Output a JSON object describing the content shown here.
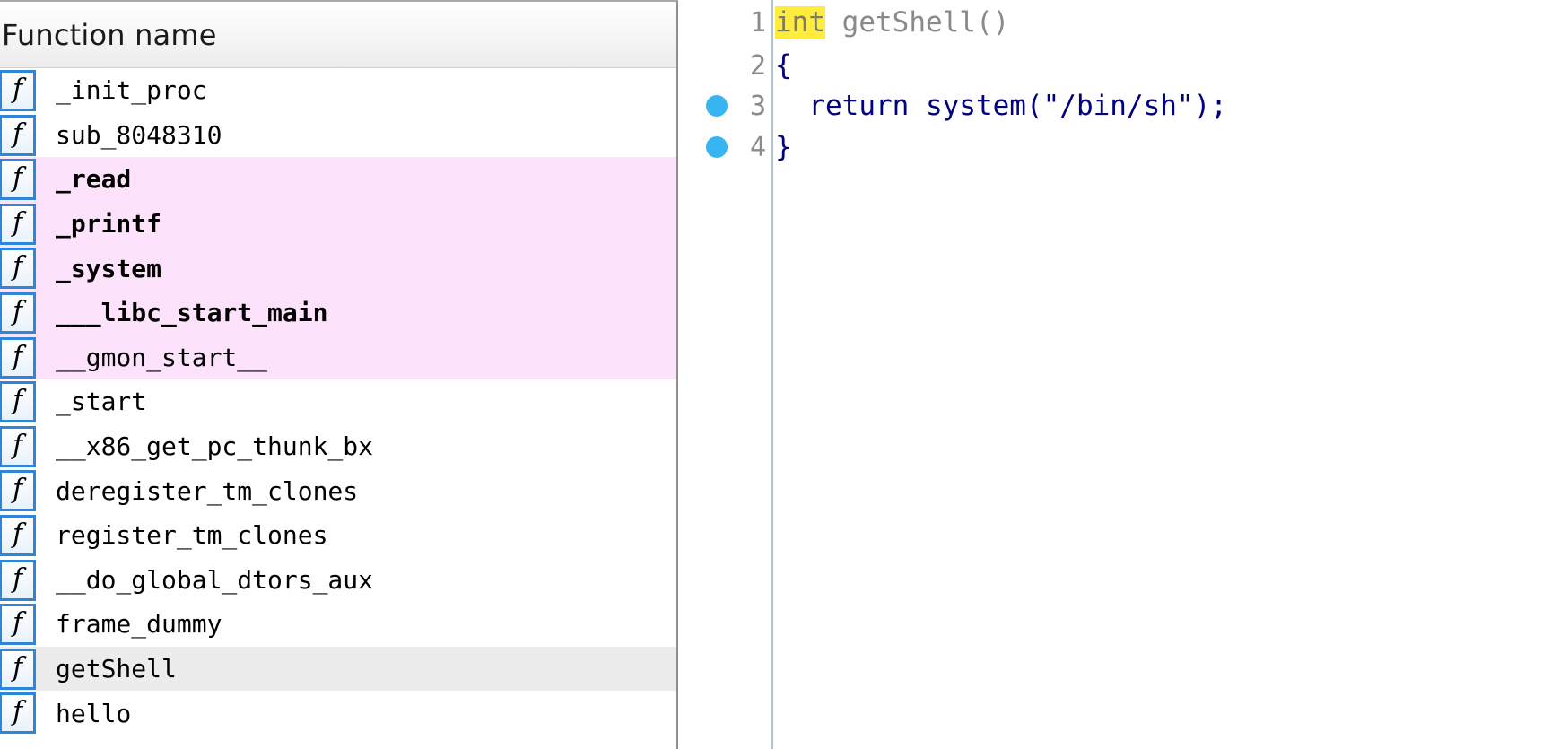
{
  "function_list": {
    "header": "Function name",
    "icon_glyph": "f",
    "rows": [
      {
        "name": "_init_proc",
        "kind": "normal"
      },
      {
        "name": "sub_8048310",
        "kind": "normal"
      },
      {
        "name": "_read",
        "kind": "library"
      },
      {
        "name": "_printf",
        "kind": "library"
      },
      {
        "name": "_system",
        "kind": "library"
      },
      {
        "name": "___libc_start_main",
        "kind": "library"
      },
      {
        "name": "__gmon_start__",
        "kind": "library"
      },
      {
        "name": "_start",
        "kind": "normal"
      },
      {
        "name": "__x86_get_pc_thunk_bx",
        "kind": "normal"
      },
      {
        "name": "deregister_tm_clones",
        "kind": "normal"
      },
      {
        "name": "register_tm_clones",
        "kind": "normal"
      },
      {
        "name": "__do_global_dtors_aux",
        "kind": "normal"
      },
      {
        "name": "frame_dummy",
        "kind": "normal"
      },
      {
        "name": "getShell",
        "kind": "selected"
      },
      {
        "name": "hello",
        "kind": "normal"
      }
    ]
  },
  "pseudocode": {
    "lines": [
      {
        "number": "1",
        "breakpoint": false,
        "parts": {
          "kw": "int",
          "rest": " getShell()"
        }
      },
      {
        "number": "2",
        "breakpoint": false,
        "parts": {
          "text": "{"
        }
      },
      {
        "number": "3",
        "breakpoint": true,
        "parts": {
          "indent": "  ",
          "kw": "return",
          "call": " system(",
          "str": "\"/bin/sh\"",
          "end": ");"
        }
      },
      {
        "number": "4",
        "breakpoint": true,
        "parts": {
          "text": "}"
        }
      }
    ]
  },
  "colors": {
    "library_row_bg": "#fde2fb",
    "selected_row_bg": "#ececec",
    "icon_border": "#2f86d8",
    "breakpoint_dot": "#37b4f2",
    "keyword_highlight": "#ffec3d",
    "code_navy": "#000080"
  }
}
